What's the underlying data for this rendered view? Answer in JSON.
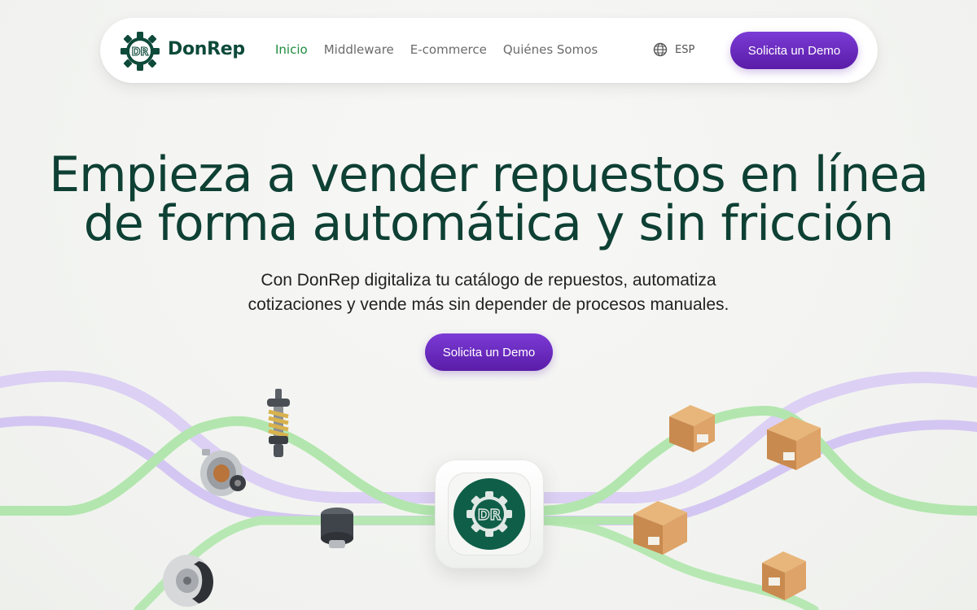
{
  "brand": {
    "name": "DonRep",
    "logo_text": "DR"
  },
  "nav": {
    "items": [
      {
        "label": "Inicio",
        "active": true
      },
      {
        "label": "Middleware",
        "active": false
      },
      {
        "label": "E-commerce",
        "active": false
      },
      {
        "label": "Quiénes Somos",
        "active": false
      }
    ],
    "language": "ESP",
    "cta": "Solicita un Demo"
  },
  "hero": {
    "title_line1": "Empieza a vender repuestos en línea",
    "title_line2": "de forma automática y sin fricción",
    "subtitle_line1": "Con DonRep digitaliza tu catálogo de repuestos, automatiza",
    "subtitle_line2": "cotizaciones y vende más sin depender de procesos manuales.",
    "cta": "Solicita un Demo"
  },
  "colors": {
    "brand_green": "#0e4034",
    "accent_green": "#1f8a3e",
    "cta_purple": "#6a2bc2",
    "flow_green": "#a9e3a6",
    "flow_purple": "#d4c6f2"
  },
  "icons": [
    "gear-logo-icon",
    "globe-icon",
    "shock-absorber-icon",
    "alternator-icon",
    "air-filter-icon",
    "brake-disc-icon",
    "package-box-icon"
  ]
}
